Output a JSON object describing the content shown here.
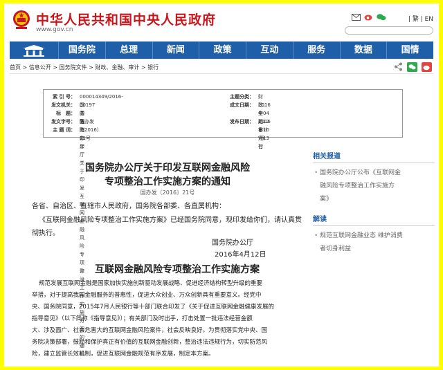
{
  "header": {
    "site_title": "中华人民共和国中央人民政府",
    "site_url": "www.gov.cn",
    "lang_links": "| 繁 | EN"
  },
  "nav": {
    "items": [
      "国务院",
      "总理",
      "新闻",
      "政策",
      "互动",
      "服务",
      "数据",
      "国情"
    ]
  },
  "breadcrumb": {
    "path": "首页 > 信息公开 > 国务院文件 > 财政、金融、审计 > 银行"
  },
  "info": {
    "index_label": "索 引 号：",
    "index_value": "000014349/2016-00197",
    "topic_label": "主题分类：",
    "topic_value": "财政、金融、审计\\银行",
    "org_label": "发文机关：",
    "org_value": "国务院办公厅",
    "created_label": "成文日期：",
    "created_value": "2016年04月12日",
    "title_label": "标　题：",
    "title_value": "国务院办公厅关于印发互联网金融风险专项整治工作实施方案的通知",
    "docnum_label": "发文字号：",
    "docnum_value": "国办发〔2016〕21号",
    "pub_label": "发布日期：",
    "pub_value": "2016年10月13日",
    "keywords_label": "主 题 词："
  },
  "doc": {
    "title_line1": "国务院办公厅关于印发互联网金融风险",
    "title_line2": "专项整治工作实施方案的通知",
    "docno": "国办发〔2016〕21号",
    "addressees": "各省、自治区、直辖市人民政府，国务院各部委、各直属机构：",
    "intro": "《互联网金融风险专项整治工作实施方案》已经国务院同意，现印发给你们，请认真贯彻执行。",
    "intro_line1": "《互联网金融风险专项整治工作实施方案》已经国务院同意，现印发给你们，请认真贯",
    "intro_line2": "彻执行。",
    "signer": "国务院办公厅",
    "sign_date": "2016年4月12日",
    "section_title": "互联网金融风险专项整治工作实施方案",
    "body_lines": [
      "规范发展互联网金融是国家加快实施创新驱动发展战略、促进经济结构转型升级的重要",
      "举措，对于提高我国金融服务的普惠性，促进大众创业、万众创新具有重要意义。经党中",
      "央、国务院同意，2015年7月人民银行等十部门联合印发了《关于促进互联网金融健康发展的",
      "指导意见》（以下简称《指导意见》）；有关部门及时出手，打击处置一批违法经营金额",
      "大、涉及面广、社会危害大的互联网金融风险案件，社会反映良好。为贯彻落实党中央、国",
      "务院决策部署，鼓励和保护真正有价值的互联网金融创新，整治违法违规行为，切实防范风",
      "险，建立监管长效机制，促进互联网金融规范有序发展，制定本方案。"
    ]
  },
  "sidebar": {
    "related_heading": "相关报道",
    "related_link": "国务院办公厅公布《互联网金融风险专项整治工作实施方案》",
    "related_link_lines": [
      "国务院办公厅公布《互联网金",
      "融风险专项整治工作实施方",
      "案》"
    ],
    "interp_heading": "解读",
    "interp_link_lines": [
      "规范互联网金融业态 维护消费",
      "者切身利益"
    ]
  },
  "colors": {
    "brand_red": "#c8161d",
    "nav_blue": "#1f5ea8",
    "frame_yellow": "#ffff00"
  },
  "icons": [
    "national-emblem-icon",
    "mail-icon",
    "weibo-icon",
    "wechat-icon",
    "share-icon",
    "wechat-share-icon",
    "weibo-share-icon",
    "home-gate-icon"
  ]
}
